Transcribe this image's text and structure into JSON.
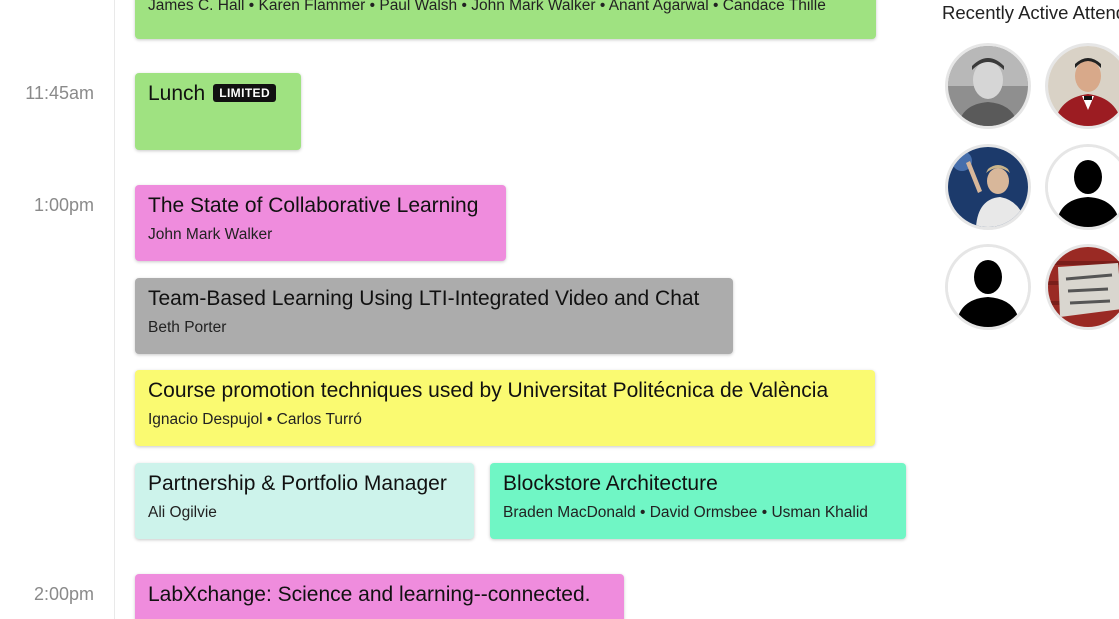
{
  "colors": {
    "green": "#9fe281",
    "pink": "#ef8cdd",
    "gray": "#acacac",
    "yellow": "#fafa71",
    "mint": "#cdf3eb",
    "teal": "#70f6c5"
  },
  "schedule": {
    "times": [
      "11:45am",
      "1:00pm",
      "2:00pm"
    ],
    "sessions": [
      {
        "title": "",
        "speakers": "James C. Hall • Karen Flammer • Paul Walsh • John Mark Walker • Anant Agarwal • Candace Thille",
        "color": "green"
      },
      {
        "title": "Lunch",
        "badge": "LIMITED",
        "speakers": "",
        "color": "green"
      },
      {
        "title": "The State of Collaborative Learning",
        "speakers": "John Mark Walker",
        "color": "pink"
      },
      {
        "title": "Team-Based Learning Using LTI-Integrated Video and Chat",
        "speakers": "Beth Porter",
        "color": "gray"
      },
      {
        "title": "Course promotion techniques used by Universitat Politécnica de València",
        "speakers": "Ignacio Despujol • Carlos Turró",
        "color": "yellow"
      },
      {
        "title": "Partnership & Portfolio Manager",
        "speakers": "Ali Ogilvie",
        "color": "mint"
      },
      {
        "title": "Blockstore Architecture",
        "speakers": "Braden MacDonald • David Ormsbee • Usman Khalid",
        "color": "teal"
      },
      {
        "title": "LabXchange: Science and learning--connected.",
        "speakers": "",
        "color": "pink"
      }
    ]
  },
  "attendees": {
    "title": "Recently Active Attendees",
    "avatars": [
      {
        "icon": "person-photo-icon"
      },
      {
        "icon": "person-photo-icon"
      },
      {
        "icon": "person-photo-icon"
      },
      {
        "icon": "default-avatar-icon"
      },
      {
        "icon": "default-avatar-icon"
      },
      {
        "icon": "sign-photo-icon"
      }
    ]
  }
}
